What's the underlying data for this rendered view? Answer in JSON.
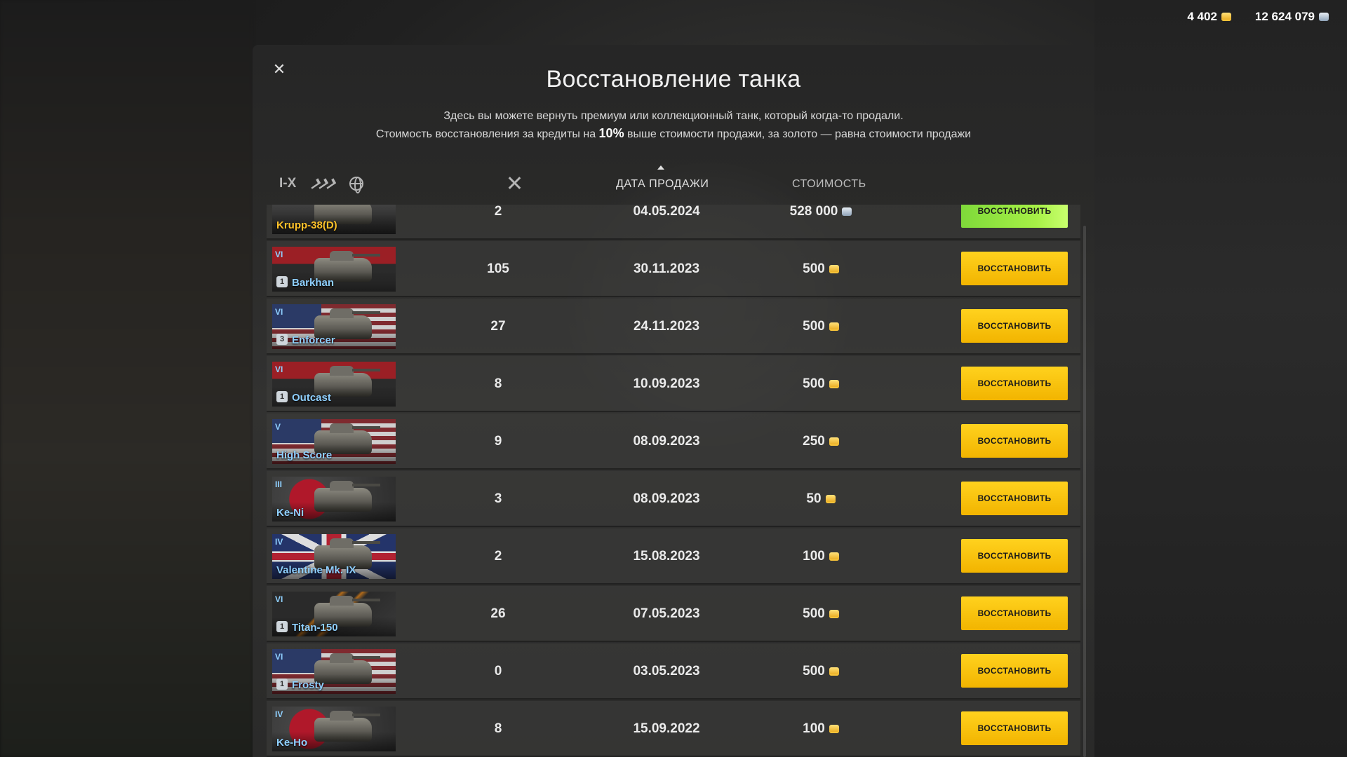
{
  "currency": {
    "gold": "4 402",
    "credits": "12 624 079"
  },
  "modal": {
    "title": "Восстановление танка",
    "desc_line1": "Здесь вы можете вернуть премиум или коллекционный танк, который когда-то продали.",
    "desc_line2_pre": "Стоимость восстановления за кредиты на ",
    "desc_line2_bold": "10%",
    "desc_line2_post": " выше стоимости продажи, за золото — равна стоимости продажи"
  },
  "filters": {
    "tier": "I-X"
  },
  "columns": {
    "date": "ДАТА ПРОДАЖИ",
    "cost": "СТОИМОСТЬ"
  },
  "restore_label": "ВОССТАНОВИТЬ",
  "rows": [
    {
      "name": "Krupp-38(D)",
      "tier": "",
      "mastery": "",
      "battles": "2",
      "date": "04.05.2024",
      "cost": "528 000",
      "currency": "credits",
      "flag": "grey",
      "name_color": "gold"
    },
    {
      "name": "Barkhan",
      "tier": "VI",
      "mastery": "1",
      "battles": "105",
      "date": "30.11.2023",
      "cost": "500",
      "currency": "gold",
      "flag": "de"
    },
    {
      "name": "Enforcer",
      "tier": "VI",
      "mastery": "3",
      "battles": "27",
      "date": "24.11.2023",
      "cost": "500",
      "currency": "gold",
      "flag": "us"
    },
    {
      "name": "Outcast",
      "tier": "VI",
      "mastery": "1",
      "battles": "8",
      "date": "10.09.2023",
      "cost": "500",
      "currency": "gold",
      "flag": "de"
    },
    {
      "name": "High Score",
      "tier": "V",
      "mastery": "",
      "battles": "9",
      "date": "08.09.2023",
      "cost": "250",
      "currency": "gold",
      "flag": "us"
    },
    {
      "name": "Ke-Ni",
      "tier": "III",
      "mastery": "",
      "battles": "3",
      "date": "08.09.2023",
      "cost": "50",
      "currency": "gold",
      "flag": "jp"
    },
    {
      "name": "Valentine Mk. IX",
      "tier": "IV",
      "mastery": "",
      "battles": "2",
      "date": "15.08.2023",
      "cost": "100",
      "currency": "gold",
      "flag": "uk"
    },
    {
      "name": "Titan-150",
      "tier": "VI",
      "mastery": "1",
      "battles": "26",
      "date": "07.05.2023",
      "cost": "500",
      "currency": "gold",
      "flag": "orange"
    },
    {
      "name": "Frosty",
      "tier": "VI",
      "mastery": "1",
      "battles": "0",
      "date": "03.05.2023",
      "cost": "500",
      "currency": "gold",
      "flag": "us"
    },
    {
      "name": "Ke-Ho",
      "tier": "IV",
      "mastery": "",
      "battles": "8",
      "date": "15.09.2022",
      "cost": "100",
      "currency": "gold",
      "flag": "jp"
    }
  ]
}
